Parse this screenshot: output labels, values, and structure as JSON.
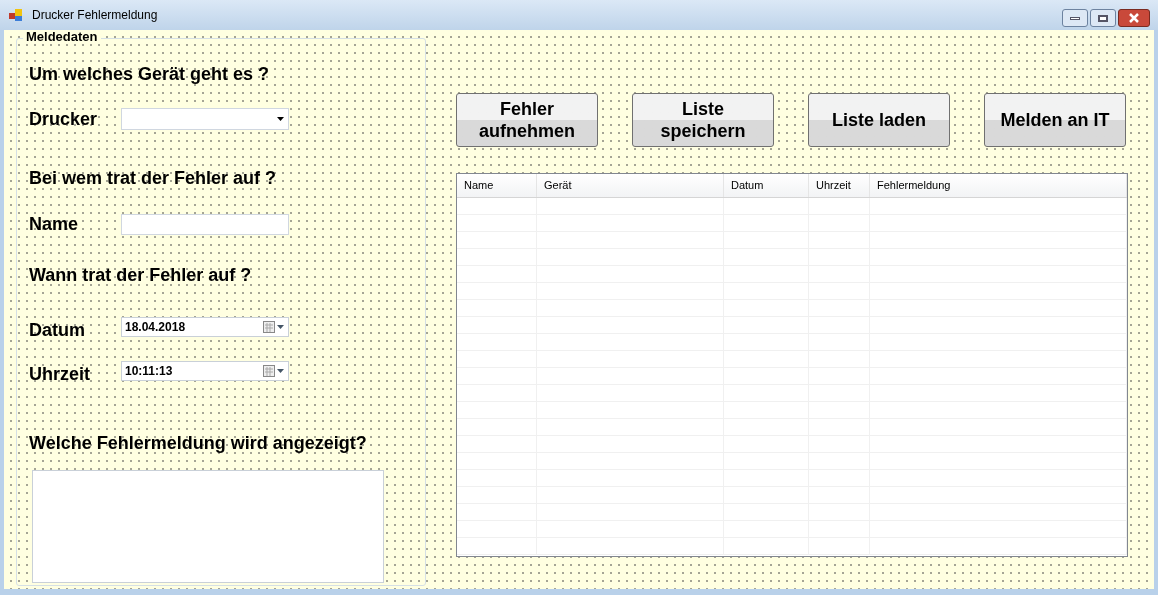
{
  "window": {
    "title": "Drucker Fehlermeldung"
  },
  "group": {
    "title": "Meldedaten",
    "device_heading": "Um welches Gerät geht es ?",
    "printer_label": "Drucker",
    "person_heading": "Bei wem trat der Fehler auf ?",
    "name_label": "Name",
    "time_heading": "Wann trat der Fehler auf ?",
    "date_label": "Datum",
    "date_value": "18.04.2018",
    "time_label": "Uhrzeit",
    "time_value": "10:11:13",
    "message_heading": "Welche Fehlermeldung wird angezeigt?"
  },
  "buttons": [
    {
      "label": "Fehler aufnehmen"
    },
    {
      "label": "Liste speichern"
    },
    {
      "label": "Liste laden"
    },
    {
      "label": "Melden an IT"
    }
  ],
  "table": {
    "columns": [
      "Name",
      "Gerät",
      "Datum",
      "Uhrzeit",
      "Fehlermeldung"
    ]
  }
}
